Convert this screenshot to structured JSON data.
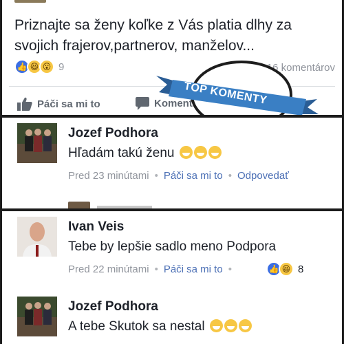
{
  "post": {
    "text": "Priznajte sa ženy koľke z Vás platia dlhy za svojich frajerov,partnerov, manželov...",
    "reaction_icons": [
      "like-icon",
      "haha-icon",
      "wow-icon"
    ],
    "reaction_count": "9",
    "comment_count": "16 komentárov",
    "like_label": "Páči sa mi to",
    "comment_label": "Komentovať"
  },
  "badge": {
    "text": "TOP KOMENTY",
    "color": "#3a7fc4"
  },
  "comments": [
    {
      "name": "Jozef Podhora",
      "text": "Hľadám takú ženu",
      "emoji_count": 3,
      "time": "Pred 23 minútami",
      "like": "Páči sa mi to",
      "reply": "Odpovedať"
    },
    {
      "name": "Ivan Veis",
      "text": "Tebe by lepšie sadlo meno Podpora",
      "time": "Pred 22 minútami",
      "like": "Páči sa mi to",
      "reaction_icons": [
        "like-icon",
        "haha-icon"
      ],
      "reaction_count": "8"
    },
    {
      "name": "Jozef Podhora",
      "text": "A tebe Skutok sa nestal",
      "emoji_count": 3
    }
  ],
  "colors": {
    "link": "#4b6fb5",
    "muted": "#90949c",
    "like_blue": "#3b6ee4",
    "emoji_yellow": "#f7c744"
  }
}
